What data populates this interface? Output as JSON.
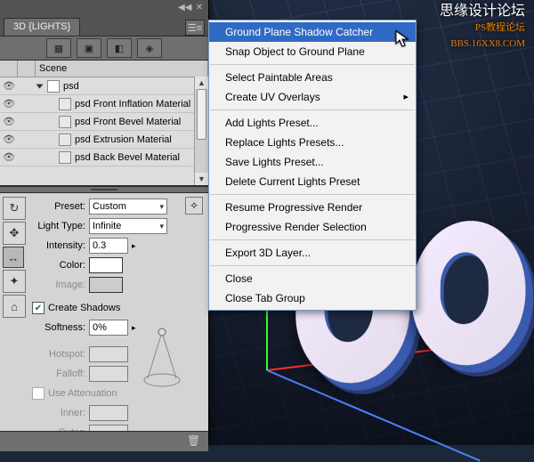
{
  "panel": {
    "tab_title": "3D {LIGHTS}",
    "toolbar_icons": [
      "scene-filter-icon",
      "mesh-filter-icon",
      "material-filter-icon",
      "light-filter-icon"
    ],
    "scene_header": {
      "col1": "",
      "col2": "",
      "col3": "Scene"
    },
    "scene_root": "psd",
    "scene_items": [
      "psd Front Inflation Material",
      "psd Front Bevel Material",
      "psd Extrusion Material",
      "psd Back Bevel Material"
    ],
    "props": {
      "preset_label": "Preset:",
      "preset_value": "Custom",
      "light_type_label": "Light Type:",
      "light_type_value": "Infinite",
      "intensity_label": "Intensity:",
      "intensity_value": "0.3",
      "color_label": "Color:",
      "image_label": "Image:",
      "create_shadows_label": "Create Shadows",
      "create_shadows_checked": true,
      "softness_label": "Softness:",
      "softness_value": "0%",
      "hotspot_label": "Hotspot:",
      "falloff_label": "Falloff:",
      "use_atten_label": "Use Attenuation",
      "inner_label": "Inner:",
      "outer_label": "Outer:"
    }
  },
  "menu": {
    "items": [
      {
        "label": "Ground Plane Shadow Catcher",
        "hover": true
      },
      {
        "label": "Snap Object to Ground Plane"
      },
      {
        "sep": true
      },
      {
        "label": "Select Paintable Areas"
      },
      {
        "label": "Create UV Overlays",
        "submenu": true
      },
      {
        "sep": true
      },
      {
        "label": "Add Lights Preset..."
      },
      {
        "label": "Replace Lights Presets..."
      },
      {
        "label": "Save Lights Preset..."
      },
      {
        "label": "Delete Current Lights Preset"
      },
      {
        "sep": true
      },
      {
        "label": "Resume Progressive Render"
      },
      {
        "label": "Progressive Render Selection"
      },
      {
        "sep": true
      },
      {
        "label": "Export 3D Layer..."
      },
      {
        "sep": true
      },
      {
        "label": "Close"
      },
      {
        "label": "Close Tab Group"
      }
    ]
  },
  "watermark": {
    "line1": "思缘设计论坛",
    "line2": "PS教程论坛",
    "line3": "BBS.16XX8.COM"
  }
}
